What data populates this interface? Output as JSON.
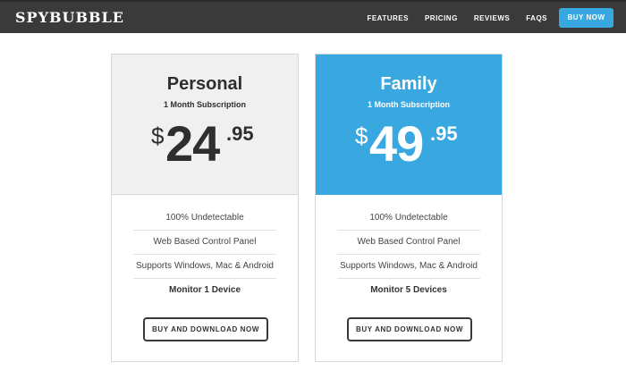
{
  "header": {
    "logo": "SPYBUBBLE",
    "nav": [
      "FEATURES",
      "PRICING",
      "REVIEWS",
      "FAQS"
    ],
    "buy_now": "BUY NOW"
  },
  "plans": [
    {
      "name": "Personal",
      "subtitle": "1 Month Subscription",
      "currency": "$",
      "price_whole": "24",
      "price_cents": ".95",
      "features": [
        "100% Undetectable",
        "Web Based Control Panel",
        "Supports Windows, Mac & Android",
        "Monitor 1 Device"
      ],
      "button": "BUY AND DOWNLOAD NOW"
    },
    {
      "name": "Family",
      "subtitle": "1 Month Subscription",
      "currency": "$",
      "price_whole": "49",
      "price_cents": ".95",
      "features": [
        "100% Undetectable",
        "Web Based Control Panel",
        "Supports Windows, Mac & Android",
        "Monitor 5 Devices"
      ],
      "button": "BUY AND DOWNLOAD NOW"
    }
  ],
  "colors": {
    "accent": "#3aa8e0",
    "header_bg": "#3a3a3a",
    "card_grey": "#f0f0f0"
  }
}
